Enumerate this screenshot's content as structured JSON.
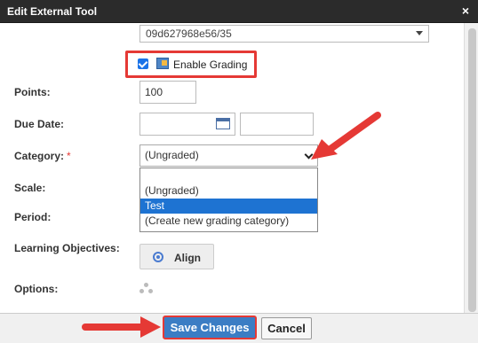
{
  "dialog": {
    "title": "Edit External Tool",
    "close_glyph": "×"
  },
  "top_select": {
    "value": "09d627968e56/35"
  },
  "enable_grading": {
    "label": "Enable Grading",
    "checked": true
  },
  "fields": {
    "points": {
      "label": "Points:",
      "value": "100"
    },
    "due_date": {
      "label": "Due Date:",
      "date_value": "",
      "time_value": ""
    },
    "category": {
      "label": "Category:",
      "required_mark": "*",
      "value": "(Ungraded)"
    },
    "scale": {
      "label": "Scale:"
    },
    "period": {
      "label": "Period:"
    },
    "learning_objectives": {
      "label": "Learning Objectives:",
      "button_label": "Align"
    },
    "options": {
      "label": "Options:"
    }
  },
  "category_dropdown": {
    "options": [
      "",
      "(Ungraded)",
      "Test",
      "(Create new grading category)"
    ],
    "selected_index": 2
  },
  "footer": {
    "save_label": "Save Changes",
    "cancel_label": "Cancel"
  },
  "colors": {
    "title_bar": "#2b2b2b",
    "accent": "#1e73d2",
    "highlight": "#e53935",
    "save_button": "#3b7dc4"
  },
  "icons": [
    "close-icon",
    "checkbox-icon",
    "grading-icon",
    "calendar-icon",
    "chevron-down-icon",
    "align-icon",
    "options-icon",
    "arrow-annotation-icon"
  ]
}
